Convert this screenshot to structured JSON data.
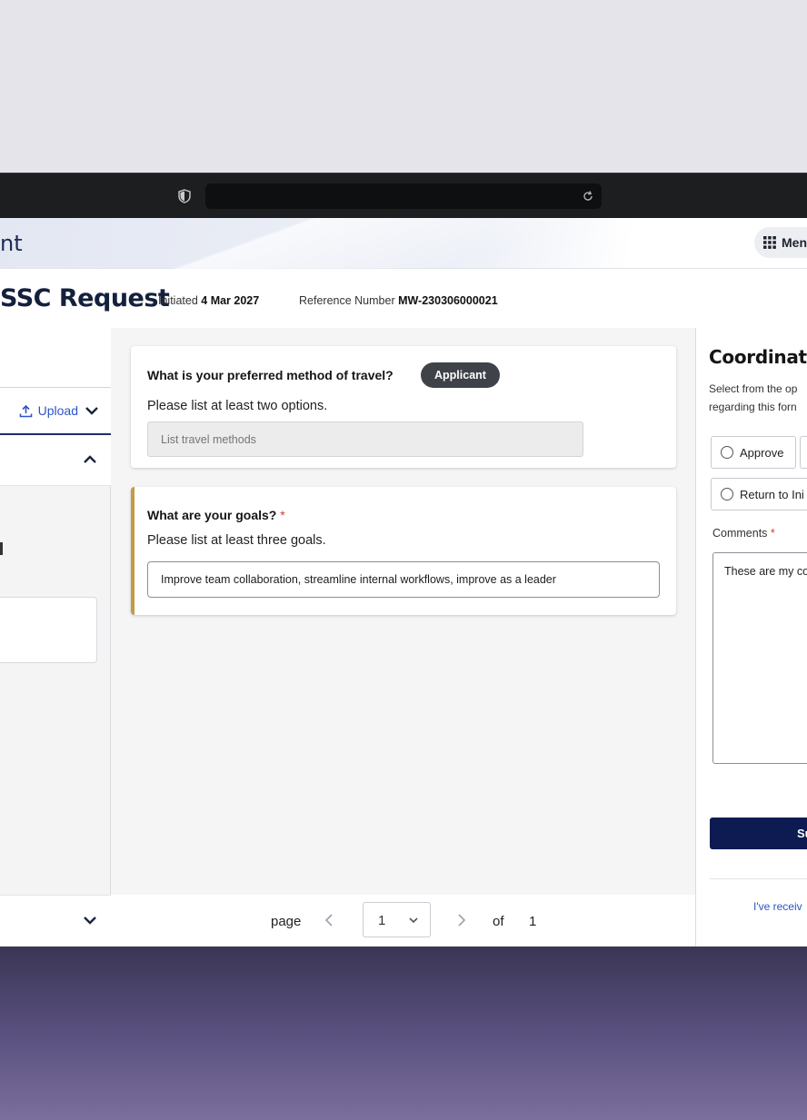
{
  "browser": {
    "address": ""
  },
  "header": {
    "app_title": "nt",
    "menu_label": "Men"
  },
  "page": {
    "title": "SSC Request",
    "initiated_label": "Initiated",
    "initiated_date": "4 Mar 2027",
    "reference_label": "Reference Number",
    "reference_number": "MW-230306000021"
  },
  "left_panel": {
    "upload_label": "Upload"
  },
  "questions": [
    {
      "title": "What is your preferred method of travel?",
      "badge": "Applicant",
      "help": "Please list at least two options.",
      "placeholder": "List travel methods",
      "value": ""
    },
    {
      "title": "What are your goals?",
      "required_mark": "*",
      "help": "Please list at least three goals.",
      "value": "Improve team collaboration, streamline internal workflows, improve as a leader"
    }
  ],
  "pager": {
    "page_label": "page",
    "current": "1",
    "of_label": "of",
    "total": "1"
  },
  "right_panel": {
    "title": "Coordinatio",
    "description_line1": "Select from the op",
    "description_line2": "regarding this forn",
    "options": [
      "Approve",
      "Return to Ini"
    ],
    "comments_label": "Comments",
    "comments_required": "*",
    "comments_value": "These are my co",
    "submit_label": "Su",
    "receive_link": "I've receiv"
  },
  "colors": {
    "navy": "#0d1b52",
    "link_blue": "#2c56c6",
    "required_red": "#d33c2e",
    "goal_accent": "#c59a42"
  }
}
